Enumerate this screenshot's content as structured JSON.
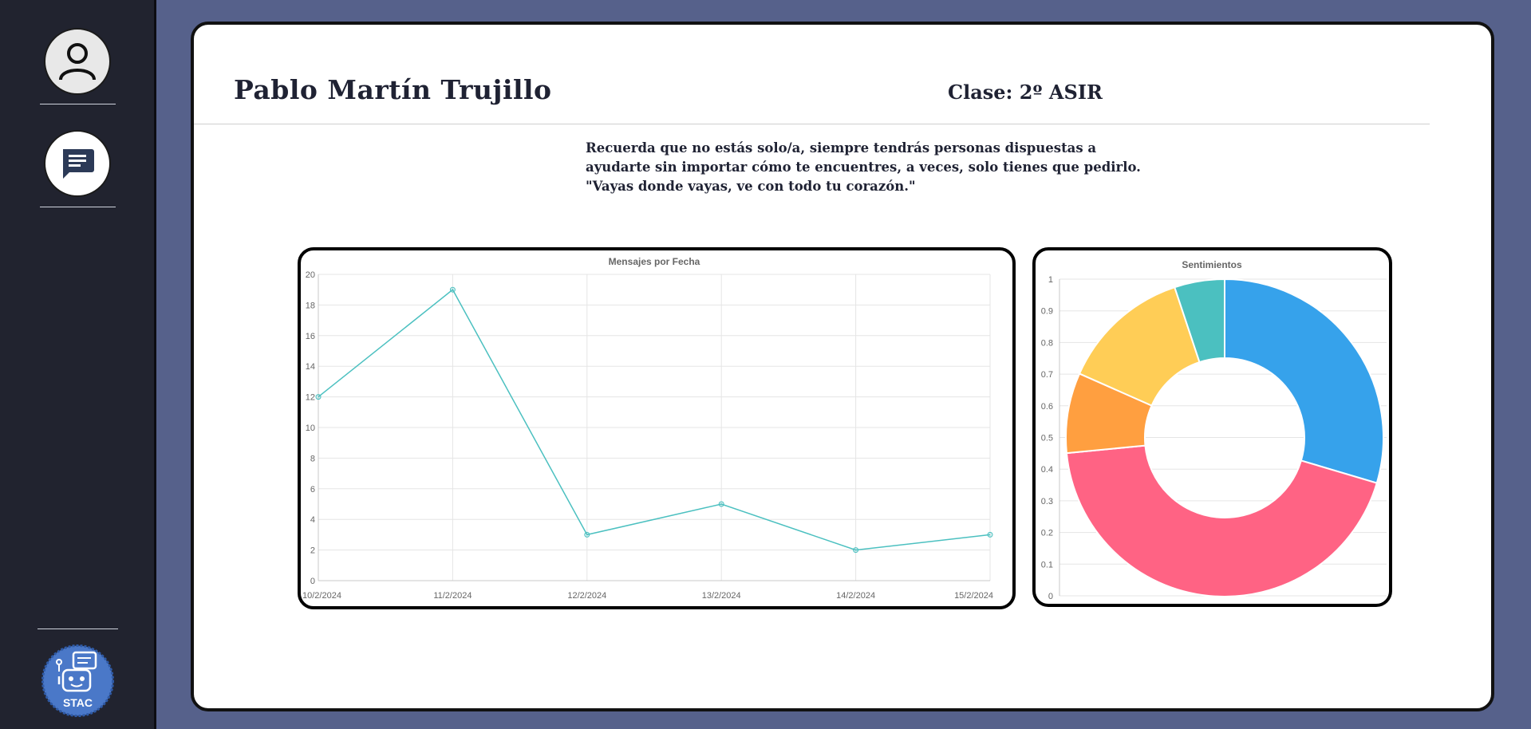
{
  "sidebar": {
    "items": [
      {
        "name": "profile",
        "icon": "user-icon"
      },
      {
        "name": "chat",
        "icon": "chat-icon"
      }
    ],
    "logo": {
      "text": "STAC",
      "icon": "robot-chat-icon",
      "color": "#4a78c8"
    }
  },
  "profile": {
    "name": "Pablo Martín Trujillo",
    "class_label": "Clase: 2º ASIR"
  },
  "quote": {
    "lines": [
      "Recuerda que no estás solo/a, siempre tendrás personas dispuestas a",
      "ayudarte sin importar cómo te encuentres, a veces, solo tienes que pedirlo.",
      "\"Vayas donde vayas, ve con todo tu corazón.\""
    ]
  },
  "chart_data": [
    {
      "type": "line",
      "title": "Mensajes por Fecha",
      "categories": [
        "10/2/2024",
        "11/2/2024",
        "12/2/2024",
        "13/2/2024",
        "14/2/2024",
        "15/2/2024"
      ],
      "values": [
        12,
        19,
        3,
        5,
        2,
        3
      ],
      "ylim": [
        0,
        20
      ],
      "yticks": [
        "0",
        "2",
        "4",
        "6",
        "8",
        "10",
        "12",
        "14",
        "16",
        "18",
        "20"
      ],
      "grid": true,
      "color": "#4bc0c0"
    },
    {
      "type": "pie",
      "title": "Sentimientos",
      "values": [
        0.29,
        0.43,
        0.08,
        0.13,
        0.05
      ],
      "colors": [
        "#36a2eb",
        "#ff6384",
        "#ff9f40",
        "#ffcd56",
        "#4bc0c0"
      ],
      "yticks": [
        "0",
        "0.1",
        "0.2",
        "0.3",
        "0.4",
        "0.5",
        "0.6",
        "0.7",
        "0.8",
        "0.9",
        "1"
      ],
      "grid": true
    }
  ]
}
